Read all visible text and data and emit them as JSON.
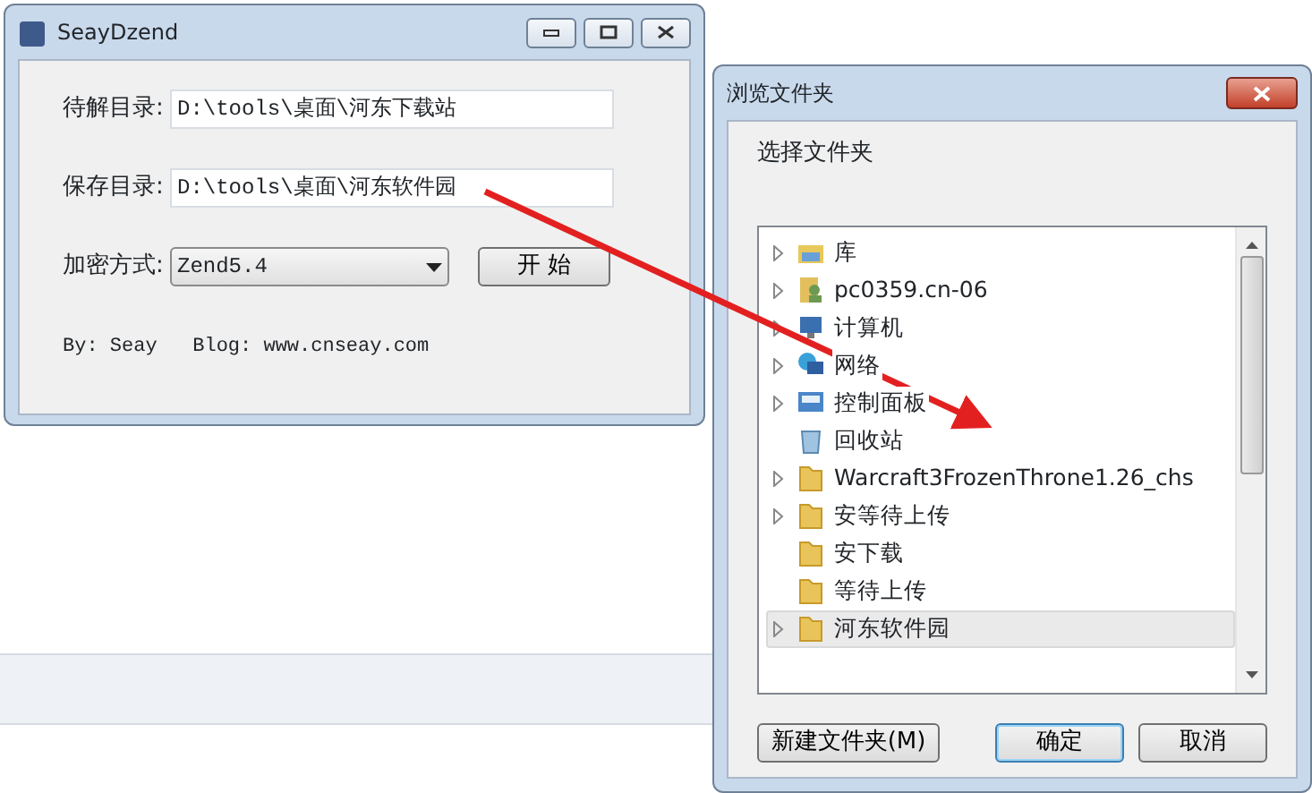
{
  "main_window": {
    "title": "SeayDzend",
    "fields": [
      {
        "label": "待解目录:",
        "value": "D:\\tools\\桌面\\河东下载站"
      },
      {
        "label": "保存目录:",
        "value": "D:\\tools\\桌面\\河东软件园"
      }
    ],
    "encryption": {
      "label": "加密方式:",
      "value": "Zend5.4"
    },
    "start_button": "开 始",
    "footer": "By: Seay   Blog: www.cnseay.com"
  },
  "dialog": {
    "title": "浏览文件夹",
    "prompt": "选择文件夹",
    "tree": [
      {
        "label": "库",
        "kind": "library",
        "expandable": true,
        "selected": false
      },
      {
        "label": "pc0359.cn-06",
        "kind": "user",
        "expandable": true,
        "selected": false
      },
      {
        "label": "计算机",
        "kind": "computer",
        "expandable": true,
        "selected": false
      },
      {
        "label": "网络",
        "kind": "network",
        "expandable": true,
        "selected": false
      },
      {
        "label": "控制面板",
        "kind": "control-panel",
        "expandable": true,
        "selected": false
      },
      {
        "label": "回收站",
        "kind": "recycle-bin",
        "expandable": false,
        "selected": false
      },
      {
        "label": "Warcraft3FrozenThrone1.26_chs",
        "kind": "folder",
        "expandable": true,
        "selected": false
      },
      {
        "label": "安等待上传",
        "kind": "folder",
        "expandable": true,
        "selected": false
      },
      {
        "label": "安下载",
        "kind": "folder",
        "expandable": false,
        "selected": false
      },
      {
        "label": "等待上传",
        "kind": "folder",
        "expandable": false,
        "selected": false
      },
      {
        "label": "河东软件园",
        "kind": "folder",
        "expandable": true,
        "selected": true
      }
    ],
    "buttons": [
      {
        "label": "新建文件夹(M)",
        "default": false
      },
      {
        "label": "确定",
        "default": true
      },
      {
        "label": "取消",
        "default": false
      }
    ]
  }
}
